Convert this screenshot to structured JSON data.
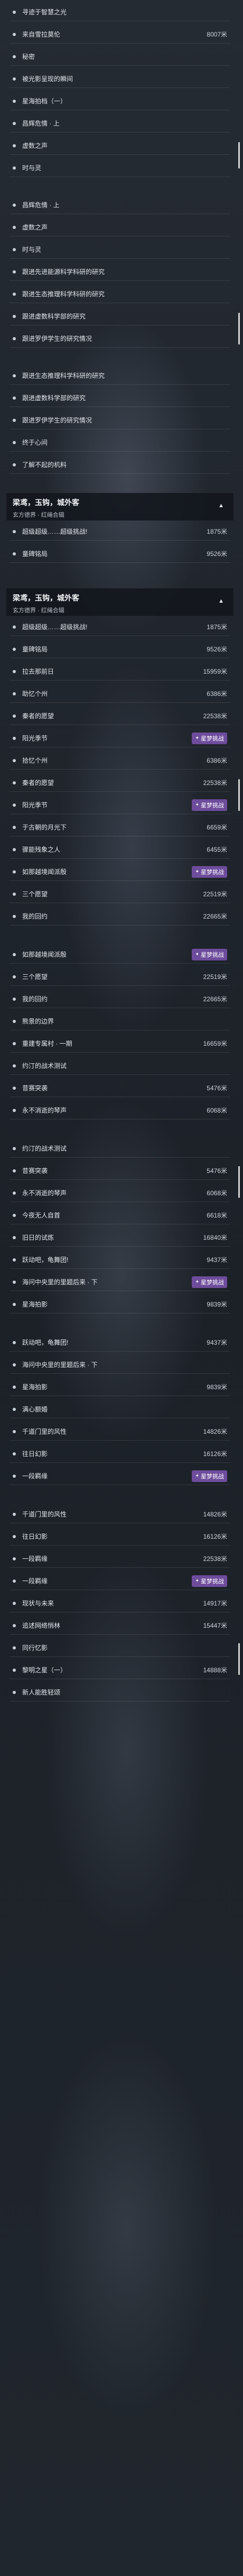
{
  "lists": [
    {
      "id": "list-a",
      "items": [
        {
          "text": "寻迹于智慧之光"
        },
        {
          "text": "来自雪拉莫伦",
          "dist": "8007米"
        },
        {
          "text": "秘密"
        },
        {
          "text": "被光影呈现的瞬间"
        },
        {
          "text": "星海拍档（一）"
        },
        {
          "text": "昌辉危情 · 上"
        },
        {
          "text": "虚数之声"
        },
        {
          "text": "时与灵"
        }
      ]
    },
    {
      "id": "list-b",
      "items": [
        {
          "text": "昌辉危情 · 上"
        },
        {
          "text": "虚数之声"
        },
        {
          "text": "时与灵"
        },
        {
          "text": "跟进先进能源科学科研的研究"
        },
        {
          "text": "跟进生态推理科学科研的研究"
        },
        {
          "text": "跟进虚数科学部的研究"
        },
        {
          "text": "跟进罗伊学生的研究情况"
        }
      ]
    },
    {
      "id": "list-c",
      "items": [
        {
          "text": "跟进生态推理科学科研的研究"
        },
        {
          "text": "跟进虚数科学部的研究"
        },
        {
          "text": "跟进罗伊学生的研究情况"
        },
        {
          "text": "终于心间"
        },
        {
          "text": "了解不起的机料"
        }
      ]
    }
  ],
  "sections": [
    {
      "title": "梁鸢，玉钩，城外客",
      "subtitle": "玄方德界 · 红绳合辑",
      "items": [
        {
          "text": "超级超级……超级挑战!",
          "dist": "1875米"
        },
        {
          "text": "童碑铭局",
          "dist": "9526米"
        }
      ]
    },
    {
      "title": "梁鸢，玉钩，城外客",
      "subtitle": "玄方德界 · 红绳合辑",
      "items": [
        {
          "text": "超级超级……超级挑战!",
          "dist": "1875米"
        },
        {
          "text": "童碑铭局",
          "dist": "9526米"
        },
        {
          "text": "拉去那前日",
          "dist": "15959米"
        },
        {
          "text": "助忆个州",
          "dist": "6386米"
        },
        {
          "text": "秦者的愿望",
          "dist": "22538米"
        },
        {
          "text": "阳光季节",
          "tag": "星梦挑战"
        },
        {
          "text": "拾忆个州",
          "dist": "6386米"
        },
        {
          "text": "秦者的愿望",
          "dist": "22538米"
        },
        {
          "text": "阳光季节",
          "tag": "星梦挑战"
        },
        {
          "text": "于古朝的月光下",
          "dist": "6659米"
        },
        {
          "text": "骤能残象之人",
          "dist": "6455米"
        },
        {
          "text": "如那越境闻派殷",
          "tag": "星梦挑战"
        },
        {
          "text": "三个愿望",
          "dist": "22519米"
        },
        {
          "text": "我的回约",
          "dist": "22665米"
        }
      ]
    }
  ],
  "list2": [
    {
      "text": "如那越境闻派殷",
      "tag": "星梦挑战"
    },
    {
      "text": "三个愿望",
      "dist": "22519米"
    },
    {
      "text": "我的回约",
      "dist": "22665米"
    },
    {
      "text": "熊景的边界"
    },
    {
      "text": "重建专属村 · 一期",
      "dist": "16659米"
    },
    {
      "text": "约汀的战术测试"
    },
    {
      "text": "昔赛突袭",
      "dist": "5476米"
    },
    {
      "text": "永不消逝的琴声",
      "dist": "6068米"
    }
  ],
  "list3": [
    {
      "text": "约汀的战术测试"
    },
    {
      "text": "昔赛突袭",
      "dist": "5476米"
    },
    {
      "text": "永不消逝的琴声",
      "dist": "6068米"
    },
    {
      "text": "今夜无人自首",
      "dist": "6618米"
    },
    {
      "text": "旧日的试炼",
      "dist": "16840米"
    },
    {
      "text": "跃动吧，龟舞团!",
      "dist": "9437米"
    },
    {
      "text": "海问中央里的里题后来 · 下",
      "tag": "星梦挑战"
    },
    {
      "text": "星海拍影",
      "dist": "9839米"
    }
  ],
  "list4": [
    {
      "text": "跃动吧，龟舞团!",
      "dist": "9437米"
    },
    {
      "text": "海问中央里的里题后来 · 下"
    },
    {
      "text": "星海拍影",
      "dist": "9839米"
    },
    {
      "text": "满心额婚"
    },
    {
      "text": "千道门里的风性",
      "dist": "14826米"
    },
    {
      "text": "往日幻影",
      "dist": "16126米"
    },
    {
      "text": "一段羁缘",
      "tag": "星梦挑战"
    }
  ],
  "list5": [
    {
      "text": "千道门里的风性",
      "dist": "14826米"
    },
    {
      "text": "往日幻影",
      "dist": "16126米"
    },
    {
      "text": "一段羁缘",
      "dist": "22538米"
    },
    {
      "text": "一段羁缘",
      "tag": "星梦挑战"
    },
    {
      "text": "现状与未来",
      "dist": "14917米"
    },
    {
      "text": "追述网络悄林",
      "dist": "15447米"
    },
    {
      "text": "同行忆影"
    },
    {
      "text": "黎明之星（一）",
      "dist": "14888米"
    },
    {
      "text": "新人能胜轻颂"
    }
  ]
}
